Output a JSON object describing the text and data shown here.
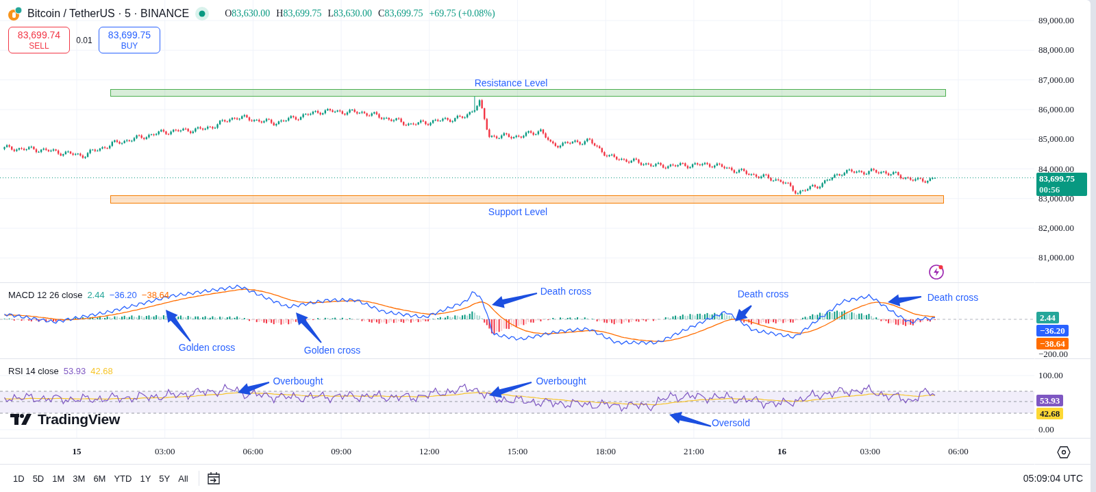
{
  "header": {
    "symbol": "Bitcoin / TetherUS · 5 · BINANCE",
    "ohlc": [
      {
        "label": "O",
        "value": "83,630.00"
      },
      {
        "label": "H",
        "value": "83,699.75"
      },
      {
        "label": "L",
        "value": "83,630.00"
      },
      {
        "label": "C",
        "value": "83,699.75"
      }
    ],
    "change": "+69.75 (+0.08%)"
  },
  "order_panel": {
    "sell": {
      "price": "83,699.74",
      "label": "SELL"
    },
    "quantity": "0.01",
    "buy": {
      "price": "83,699.75",
      "label": "BUY"
    }
  },
  "price_axis": {
    "labels": [
      "89,000.00",
      "88,000.00",
      "87,000.00",
      "86,000.00",
      "85,000.00",
      "84,000.00",
      "83,000.00",
      "82,000.00",
      "81,000.00"
    ],
    "last_price": "83,699.75",
    "countdown": "00:56"
  },
  "zones": [
    {
      "label": "Resistance Level",
      "color": "#4caf50"
    },
    {
      "label": "Support Level",
      "color": "#f57c00"
    }
  ],
  "macd": {
    "title": "MACD 12 26 close",
    "values": [
      {
        "value": "2.44",
        "color": "#26a69a"
      },
      {
        "value": "−36.20",
        "color": "#2962ff"
      },
      {
        "value": "−38.64",
        "color": "#ff6d00"
      }
    ],
    "axis_labels": [
      "−200.00"
    ],
    "badges": [
      {
        "value": "2.44",
        "color": "#26a69a"
      },
      {
        "value": "−36.20",
        "color": "#2962ff"
      },
      {
        "value": "−38.64",
        "color": "#ff6d00"
      }
    ]
  },
  "rsi": {
    "title": "RSI 14 close",
    "values": [
      {
        "value": "53.93",
        "color": "#7e57c2"
      },
      {
        "value": "42.68",
        "color": "#f7c52b"
      }
    ],
    "axis_labels": [
      "100.00",
      "0.00"
    ],
    "badges": [
      {
        "value": "53.93",
        "color": "#7e57c2"
      },
      {
        "value": "42.68",
        "color": "#fdd835"
      }
    ]
  },
  "annotations": [
    {
      "label": "Death cross"
    },
    {
      "label": "Death cross"
    },
    {
      "label": "Death cross"
    },
    {
      "label": "Golden cross"
    },
    {
      "label": "Golden cross"
    },
    {
      "label": "Overbought"
    },
    {
      "label": "Overbought"
    },
    {
      "label": "Oversold"
    }
  ],
  "logo": "TradingView",
  "time_axis": [
    {
      "label": "15",
      "kind": "day"
    },
    {
      "label": "03:00",
      "kind": "time"
    },
    {
      "label": "06:00",
      "kind": "time"
    },
    {
      "label": "09:00",
      "kind": "time"
    },
    {
      "label": "12:00",
      "kind": "time"
    },
    {
      "label": "15:00",
      "kind": "time"
    },
    {
      "label": "18:00",
      "kind": "time"
    },
    {
      "label": "21:00",
      "kind": "time"
    },
    {
      "label": "16",
      "kind": "day"
    },
    {
      "label": "03:00",
      "kind": "time"
    },
    {
      "label": "06:00",
      "kind": "time"
    }
  ],
  "range_buttons": [
    "1D",
    "5D",
    "1M",
    "3M",
    "6M",
    "YTD",
    "1Y",
    "5Y",
    "All"
  ],
  "clock": "05:09:04 UTC"
}
